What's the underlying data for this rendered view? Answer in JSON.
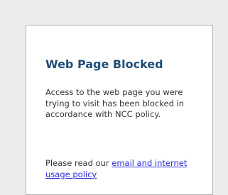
{
  "card": {
    "title": "Web Page Blocked",
    "message": "Access to the web page you were trying to visit has been blocked in accordance with NCC policy.",
    "policy_prefix": "Please read our ",
    "policy_link": "email and internet usage policy"
  },
  "colors": {
    "background": "#ececec",
    "card": "#ffffff",
    "title": "#1f4e79",
    "text": "#333333",
    "link": "#2b2bd6"
  }
}
